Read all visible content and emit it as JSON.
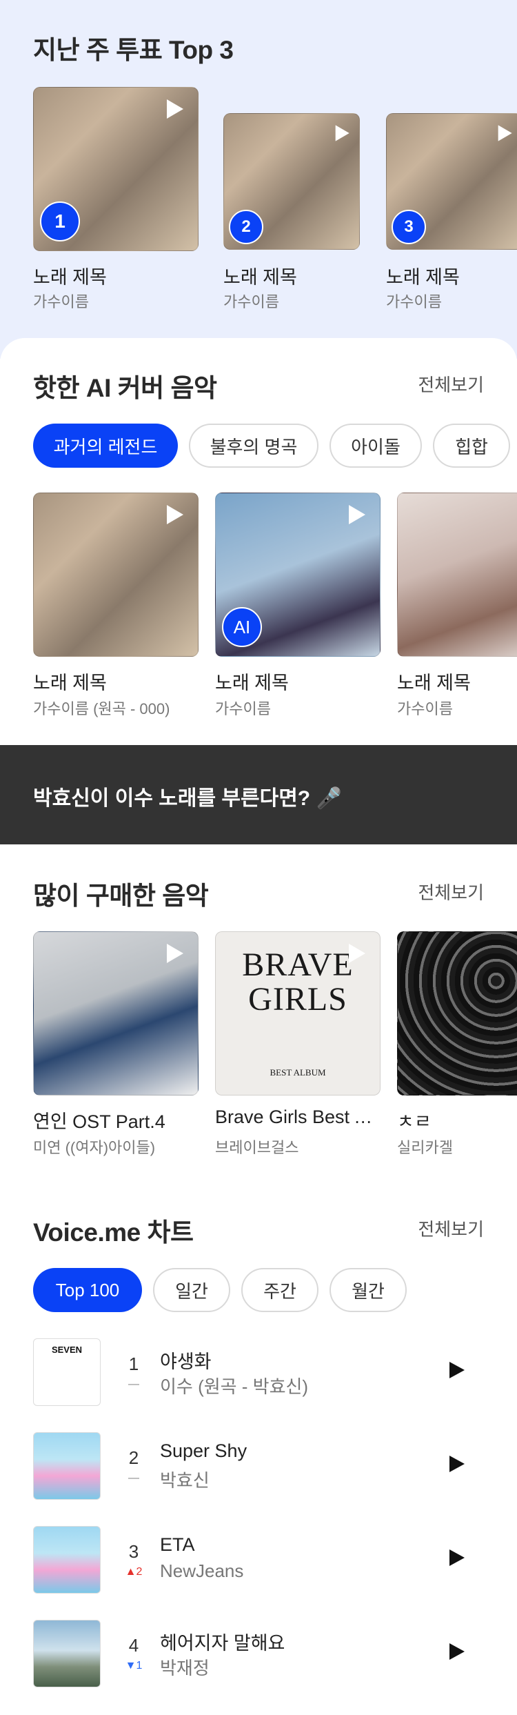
{
  "top3": {
    "heading": "지난 주 투표 Top 3",
    "items": [
      {
        "rank": "1",
        "title": "노래 제목",
        "artist": "가수이름"
      },
      {
        "rank": "2",
        "title": "노래 제목",
        "artist": "가수이름"
      },
      {
        "rank": "3",
        "title": "노래 제목",
        "artist": "가수이름"
      }
    ]
  },
  "ai_cover": {
    "heading": "핫한 AI 커버 음악",
    "view_all": "전체보기",
    "chips": [
      "과거의 레전드",
      "불후의 명곡",
      "아이돌",
      "힙합"
    ],
    "selected_chip": "과거의 레전드",
    "items": [
      {
        "title": "노래 제목",
        "artist": "가수이름 (원곡 - 000)"
      },
      {
        "title": "노래 제목",
        "artist": "가수이름",
        "badge": "AI"
      },
      {
        "title": "노래 제목",
        "artist": "가수이름"
      }
    ]
  },
  "banner": {
    "text": "박효신이 이수 노래를 부른다면? 🎤"
  },
  "purchased": {
    "heading": "많이 구매한 음악",
    "view_all": "전체보기",
    "items": [
      {
        "title": "연인 OST Part.4",
        "artist": "미연 ((여자)아이들)"
      },
      {
        "title": "Brave Girls Best Album",
        "artist": "브레이브걸스",
        "cover_line1": "BRAVE",
        "cover_line2": "GIRLS",
        "cover_sub": "BEST ALBUM"
      },
      {
        "title": "ㅊㄹ",
        "artist": "실리카겔"
      }
    ]
  },
  "chart": {
    "heading": "Voice.me 차트",
    "view_all": "전체보기",
    "tabs": [
      "Top 100",
      "일간",
      "주간",
      "월간"
    ],
    "selected_tab": "Top 100",
    "rows": [
      {
        "rank": "1",
        "change": "—",
        "change_dir": "same",
        "title": "야생화",
        "artist": "이수 (원곡 - 박효신)",
        "cover_text": "SEVEN"
      },
      {
        "rank": "2",
        "change": "—",
        "change_dir": "same",
        "title": "Super Shy",
        "artist": "박효신"
      },
      {
        "rank": "3",
        "change": "▲2",
        "change_dir": "up",
        "title": "ETA",
        "artist": "NewJeans"
      },
      {
        "rank": "4",
        "change": "▼1",
        "change_dir": "down",
        "title": "헤어지자 말해요",
        "artist": "박재정"
      }
    ]
  },
  "colors": {
    "accent": "#0a42f6",
    "top_bg": "#eaeffd",
    "banner_bg": "#333333",
    "up": "#e5322d",
    "down": "#2f6cf6"
  },
  "icons": [
    "play-icon",
    "rank-badge",
    "ai-badge"
  ]
}
